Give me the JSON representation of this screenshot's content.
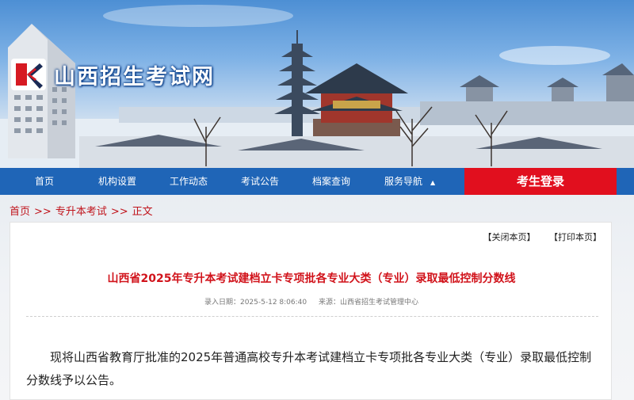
{
  "site": {
    "name": "山西招生考试网"
  },
  "nav": {
    "items": [
      {
        "label": "首页"
      },
      {
        "label": "机构设置"
      },
      {
        "label": "工作动态"
      },
      {
        "label": "考试公告"
      },
      {
        "label": "档案查询"
      },
      {
        "label": "服务导航"
      }
    ],
    "caret": "▲",
    "login": "考生登录"
  },
  "breadcrumb": {
    "items": [
      "首页",
      "专升本考试",
      "正文"
    ],
    "separator": ">>"
  },
  "tools": {
    "close": "【关闭本页】",
    "print": "【打印本页】"
  },
  "article": {
    "title": "山西省2025年专升本考试建档立卡专项批各专业大类（专业）录取最低控制分数线",
    "date_label": "录入日期：2025-5-12 8:06:40",
    "source_label": "来源：山西省招生考试管理中心",
    "body": "现将山西省教育厅批准的2025年普通高校专升本考试建档立卡专项批各专业大类（专业）录取最低控制分数线予以公告。"
  },
  "colors": {
    "nav_bg": "#1f65b7",
    "login_bg": "#e10f1e",
    "accent_red": "#d1131b"
  }
}
